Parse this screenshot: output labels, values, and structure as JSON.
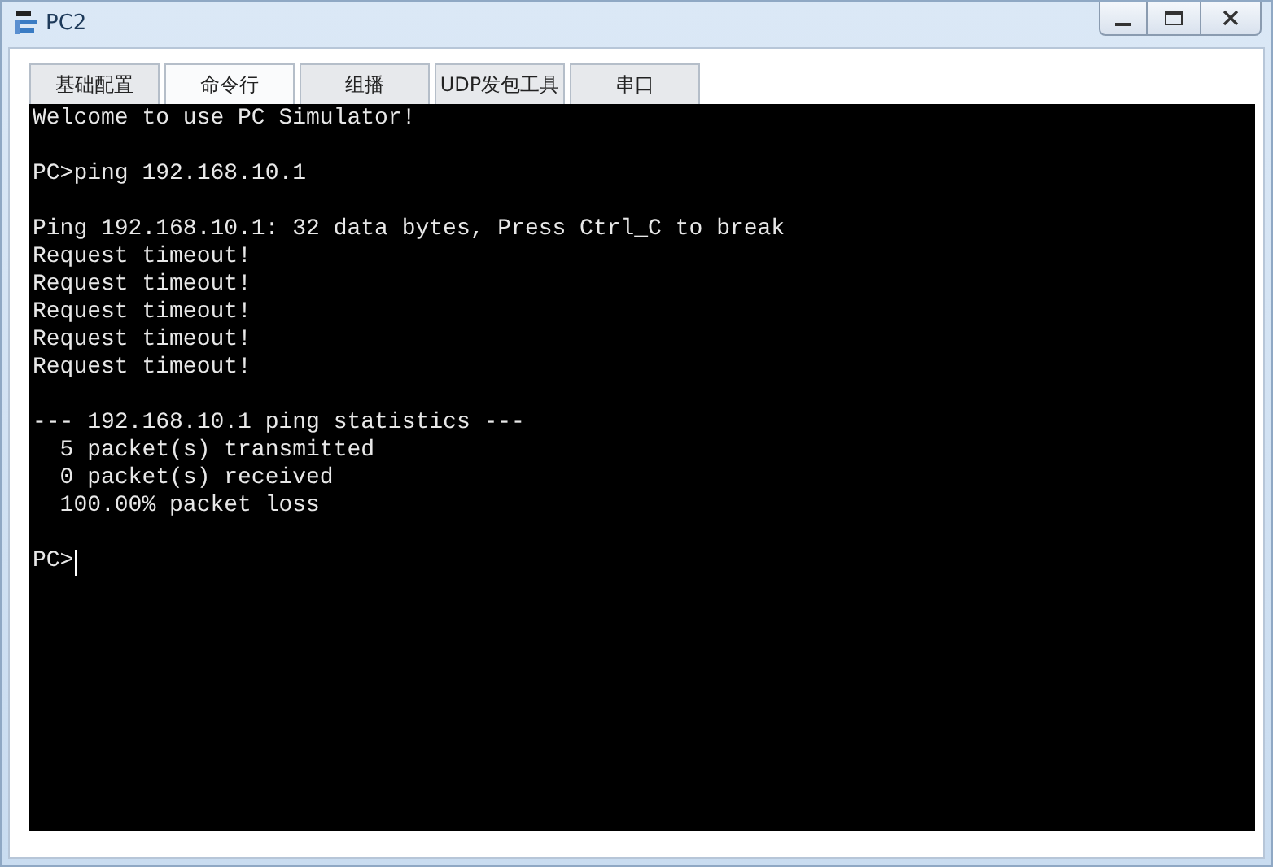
{
  "window": {
    "title": "PC2"
  },
  "tabs": [
    {
      "label": "基础配置",
      "selected": false
    },
    {
      "label": "命令行",
      "selected": true
    },
    {
      "label": "组播",
      "selected": false
    },
    {
      "label": "UDP发包工具",
      "selected": false
    },
    {
      "label": "串口",
      "selected": false
    }
  ],
  "terminal": {
    "blocks": [
      [
        "Welcome to use PC Simulator!"
      ],
      [
        "PC>ping 192.168.10.1"
      ],
      [
        "Ping 192.168.10.1: 32 data bytes, Press Ctrl_C to break",
        "Request timeout!",
        "Request timeout!",
        "Request timeout!",
        "Request timeout!",
        "Request timeout!"
      ],
      [
        "--- 192.168.10.1 ping statistics ---",
        "  5 packet(s) transmitted",
        "  0 packet(s) received",
        "  100.00% packet loss"
      ]
    ],
    "prompt": "PC>",
    "cursor": true
  }
}
